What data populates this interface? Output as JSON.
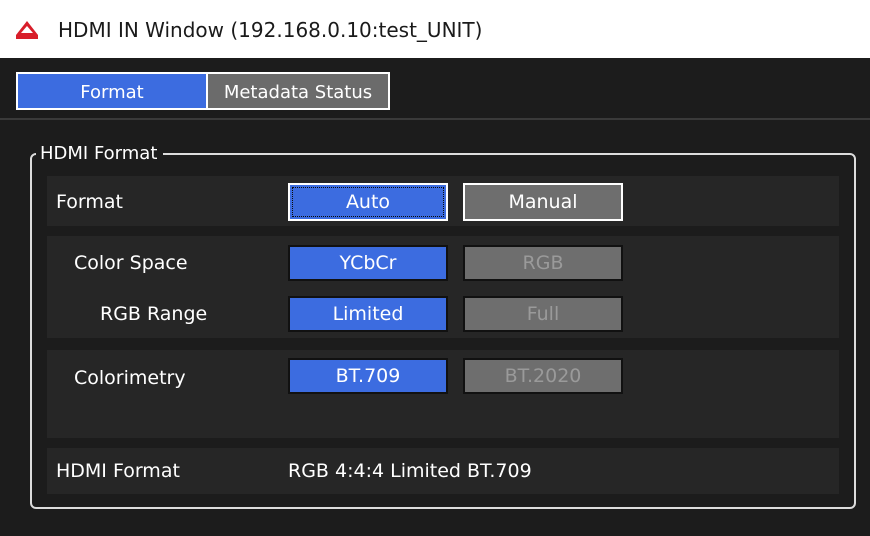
{
  "window": {
    "title": "HDMI IN Window (192.168.0.10:test_UNIT)"
  },
  "tabs": [
    {
      "label": "Format",
      "active": true
    },
    {
      "label": "Metadata Status",
      "active": false
    }
  ],
  "group": {
    "legend": "HDMI Format"
  },
  "format_row": {
    "label": "Format",
    "auto_label": "Auto",
    "manual_label": "Manual",
    "selected": "Auto"
  },
  "color_space_row": {
    "label": "Color Space",
    "options": [
      "YCbCr",
      "RGB"
    ],
    "selected": "YCbCr"
  },
  "rgb_range_row": {
    "label": "RGB Range",
    "options": [
      "Limited",
      "Full"
    ],
    "selected": "Limited"
  },
  "colorimetry_row": {
    "label": "Colorimetry",
    "options": [
      "BT.709",
      "BT.2020"
    ],
    "selected": "BT.709"
  },
  "status_row": {
    "label": "HDMI Format",
    "value": "RGB 4:4:4 Limited BT.709"
  },
  "colors": {
    "accent": "#3c6ce0",
    "inactive": "#6e6e6e",
    "background": "#1c1c1c",
    "app_icon": "#d81e2a"
  },
  "icons": {
    "app": "app-logo-icon"
  }
}
